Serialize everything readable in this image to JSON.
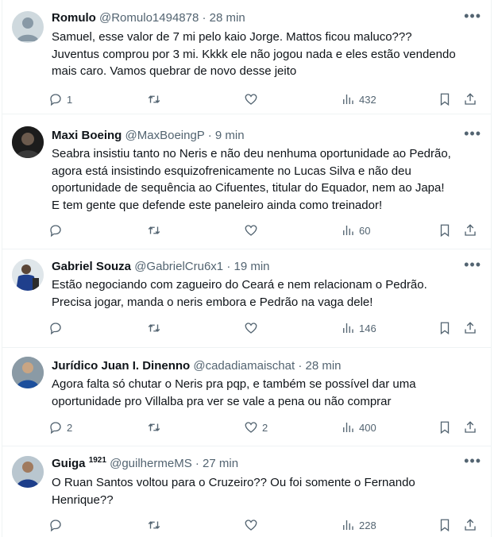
{
  "replies": [
    {
      "name": "Romulo",
      "badge": "",
      "handle": "@Romulo1494878",
      "separator": "·",
      "time": "28 min",
      "text_lines": [
        "Samuel, esse valor de 7 mi pelo kaio Jorge. Mattos ficou maluco???",
        "Juventus comprou por 3 mi. Kkkk ele não jogou nada e eles estão vendendo",
        "mais caro. Vamos quebrar de novo desse jeito"
      ],
      "replies_count": "1",
      "retweets_count": "",
      "likes_count": "",
      "views_count": "432",
      "avatar": "default-avatar-icon"
    },
    {
      "name": "Maxi Boeing",
      "badge": "",
      "handle": "@MaxBoeingP",
      "separator": "·",
      "time": "9 min",
      "text_lines": [
        "Seabra insistiu tanto no Neris e não deu nenhuma oportunidade ao Pedrão,",
        "agora está insistindo esquizofrenicamente no Lucas Silva e não deu",
        "oportunidade de sequência ao Cifuentes, titular do Equador, nem ao Japa!",
        "E tem gente que defende este paneleiro ainda como treinador!"
      ],
      "replies_count": "",
      "retweets_count": "",
      "likes_count": "",
      "views_count": "60",
      "avatar": "user-photo"
    },
    {
      "name": "Gabriel Souza",
      "badge": "",
      "handle": "@GabrielCru6x1",
      "separator": "·",
      "time": "19 min",
      "text_lines": [
        "Estão negociando com zagueiro do Ceará e nem relacionam o Pedrão.",
        "Precisa jogar, manda o neris embora e Pedrão na vaga dele!"
      ],
      "replies_count": "",
      "retweets_count": "",
      "likes_count": "",
      "views_count": "146",
      "avatar": "user-photo"
    },
    {
      "name": "Jurídico Juan I. Dinenno",
      "badge": "",
      "handle": "@cadadiamaischat",
      "separator": "·",
      "time": "28 min",
      "text_lines": [
        "Agora falta só chutar o Neris pra pqp, e também se possível dar uma",
        "oportunidade pro Villalba pra ver se vale a pena ou não comprar"
      ],
      "replies_count": "2",
      "retweets_count": "",
      "likes_count": "2",
      "views_count": "400",
      "avatar": "user-photo"
    },
    {
      "name": "Guiga",
      "badge": "1921",
      "handle": "@guilhermeMS",
      "separator": "·",
      "time": "27 min",
      "text_lines": [
        "O Ruan Santos voltou para o Cruzeiro?? Ou foi somente o Fernando",
        "Henrique??"
      ],
      "replies_count": "",
      "retweets_count": "",
      "likes_count": "",
      "views_count": "228",
      "avatar": "user-photo"
    }
  ],
  "icons": {
    "more": "more-icon",
    "reply": "reply-icon",
    "retweet": "retweet-icon",
    "like": "heart-icon",
    "views": "views-icon",
    "bookmark": "bookmark-icon",
    "share": "share-icon"
  },
  "colors": {
    "text": "#0f1419",
    "secondary": "#536471",
    "divider": "#eff3f4"
  }
}
